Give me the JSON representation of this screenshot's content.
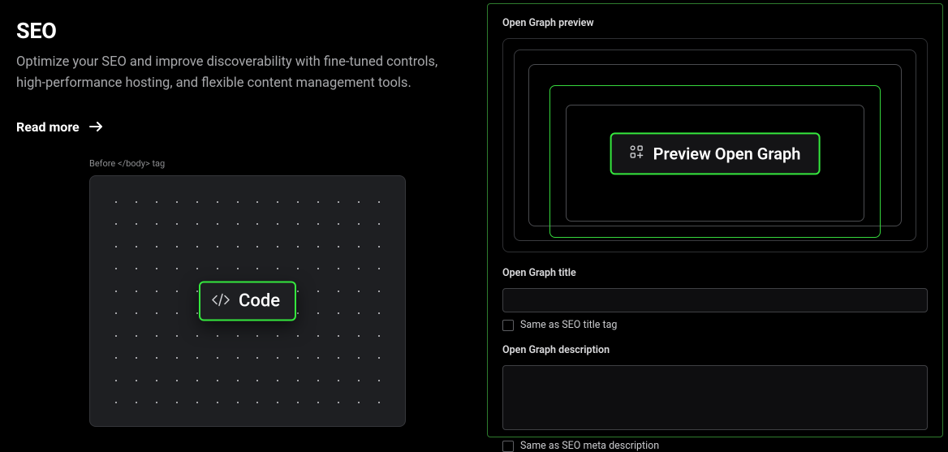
{
  "left": {
    "title": "SEO",
    "description": "Optimize your SEO and improve discoverability with fine-tuned controls, high-performance hosting, and flexible content management tools.",
    "read_more": "Read more",
    "code_card": {
      "label": "Before </body> tag",
      "badge": "Code"
    }
  },
  "right": {
    "preview_label": "Open Graph preview",
    "preview_button": "Preview Open Graph",
    "title_label": "Open Graph title",
    "title_value": "",
    "title_checkbox": "Same as SEO title tag",
    "desc_label": "Open Graph description",
    "desc_value": "",
    "desc_checkbox": "Same as SEO meta description"
  },
  "colors": {
    "accent": "#35e83e"
  }
}
